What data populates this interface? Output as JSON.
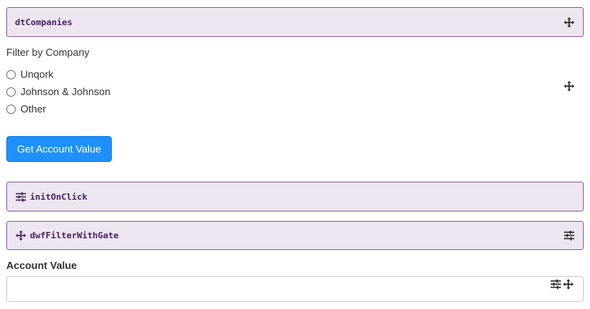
{
  "panels": {
    "dt_companies": "dtCompanies",
    "init_on_click": "initOnClick",
    "dwf_filter_with_gate": "dwfFilterWithGate"
  },
  "filter": {
    "label": "Filter by Company",
    "options": [
      "Unqork",
      "Johnson & Johnson",
      "Other"
    ],
    "selected": null
  },
  "button": {
    "label": "Get Account Value"
  },
  "account_value": {
    "label": "Account Value",
    "value": ""
  },
  "icons": {
    "move": "move-arrows-icon",
    "settings": "sliders-icon"
  },
  "colors": {
    "panel_bg": "#ede6f1",
    "panel_border": "#8e63a8",
    "panel_text": "#4a1f5f",
    "button_bg": "#1e90ff"
  }
}
